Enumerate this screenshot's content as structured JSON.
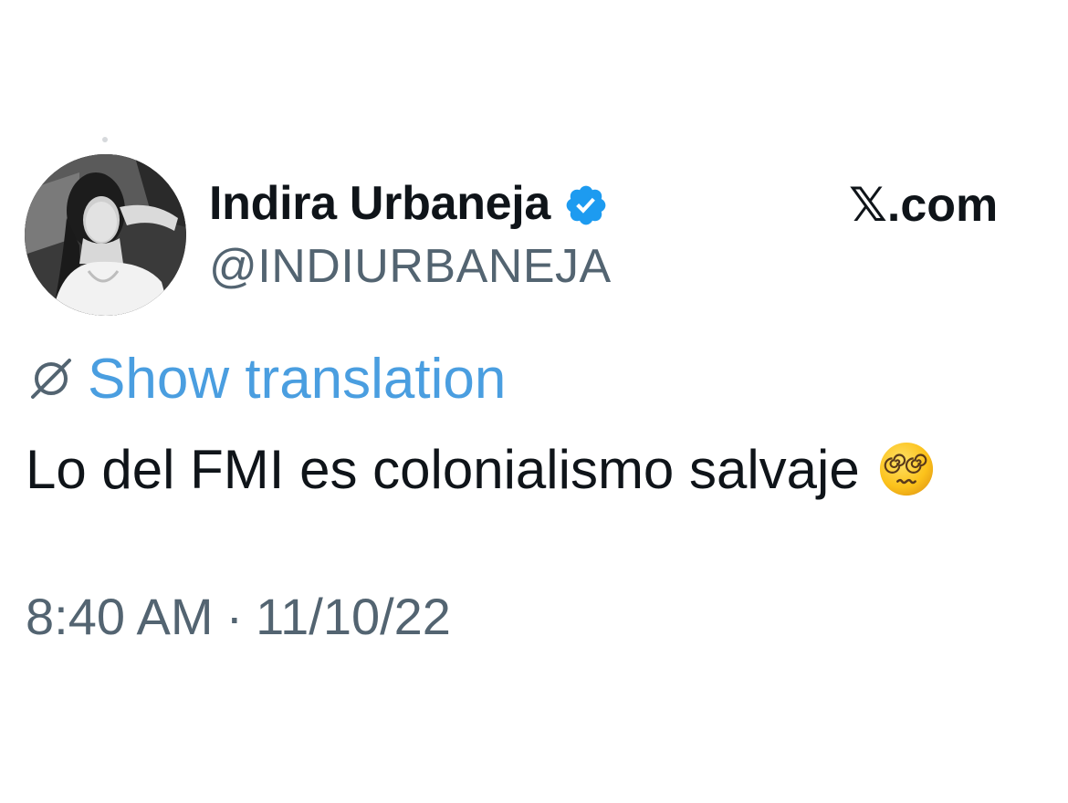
{
  "author": {
    "name": "Indira Urbaneja",
    "handle": "@INDIURBANEJA",
    "verified": true,
    "verified_color": "#1d9bf0",
    "avatar_icon": "profile-photo"
  },
  "brand": {
    "text": "𝕏.com"
  },
  "translation": {
    "icon": "globe-icon",
    "label": "Show translation",
    "color": "#4a9ee0"
  },
  "tweet": {
    "text": "Lo del FMI es colonialismo salvaje",
    "emoji": "face-with-spiral-eyes"
  },
  "meta": {
    "time": "8:40 AM",
    "separator": "·",
    "date": "11/10/22"
  }
}
